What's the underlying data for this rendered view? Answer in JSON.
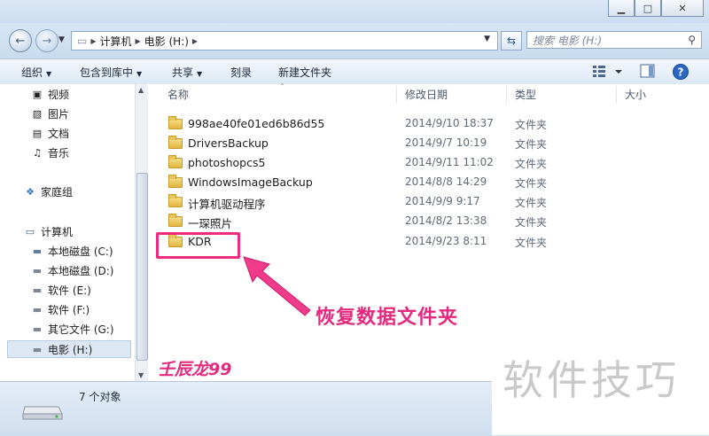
{
  "window": {
    "minimize": "▁",
    "maximize": "□",
    "close": "✕"
  },
  "address": {
    "segments": [
      "计算机",
      "电影 (H:)"
    ],
    "search_placeholder": "搜索 电影 (H:)"
  },
  "toolbar": {
    "organize": "组织",
    "include_library": "包含到库中",
    "share": "共享",
    "burn": "刻录",
    "new_folder": "新建文件夹"
  },
  "sidebar": {
    "items": [
      {
        "label": "视频",
        "icon": "video-library-icon"
      },
      {
        "label": "图片",
        "icon": "pictures-library-icon"
      },
      {
        "label": "文档",
        "icon": "documents-library-icon"
      },
      {
        "label": "音乐",
        "icon": "music-library-icon"
      },
      {
        "label": "家庭组",
        "icon": "homegroup-icon"
      },
      {
        "label": "计算机",
        "icon": "computer-icon"
      },
      {
        "label": "本地磁盘 (C:)",
        "icon": "system-drive-icon"
      },
      {
        "label": "本地磁盘 (D:)",
        "icon": "drive-icon"
      },
      {
        "label": "软件 (E:)",
        "icon": "drive-icon"
      },
      {
        "label": "软件 (F:)",
        "icon": "drive-icon"
      },
      {
        "label": "其它文件 (G:)",
        "icon": "drive-icon"
      },
      {
        "label": "电影 (H:)",
        "icon": "drive-icon",
        "selected": true
      }
    ]
  },
  "columns": {
    "name": "名称",
    "modified": "修改日期",
    "type": "类型",
    "size": "大小"
  },
  "files": [
    {
      "name": "998ae40fe01ed6b86d55",
      "modified": "2014/9/10 18:37",
      "type": "文件夹"
    },
    {
      "name": "DriversBackup",
      "modified": "2014/9/7 10:19",
      "type": "文件夹"
    },
    {
      "name": "photoshopcs5",
      "modified": "2014/9/11 11:02",
      "type": "文件夹"
    },
    {
      "name": "WindowsImageBackup",
      "modified": "2014/8/8 14:29",
      "type": "文件夹"
    },
    {
      "name": "计算机驱动程序",
      "modified": "2014/9/9 9:17",
      "type": "文件夹"
    },
    {
      "name": "一琛照片",
      "modified": "2014/8/2 13:38",
      "type": "文件夹"
    },
    {
      "name": "KDR",
      "modified": "2014/9/23 8:11",
      "type": "文件夹"
    }
  ],
  "annotation": {
    "label": "恢复数据文件夹",
    "signature": "壬辰龙99",
    "color": "#e32a7f"
  },
  "status": {
    "item_count": "7 个对象"
  },
  "watermark": {
    "text": "软件技巧"
  }
}
